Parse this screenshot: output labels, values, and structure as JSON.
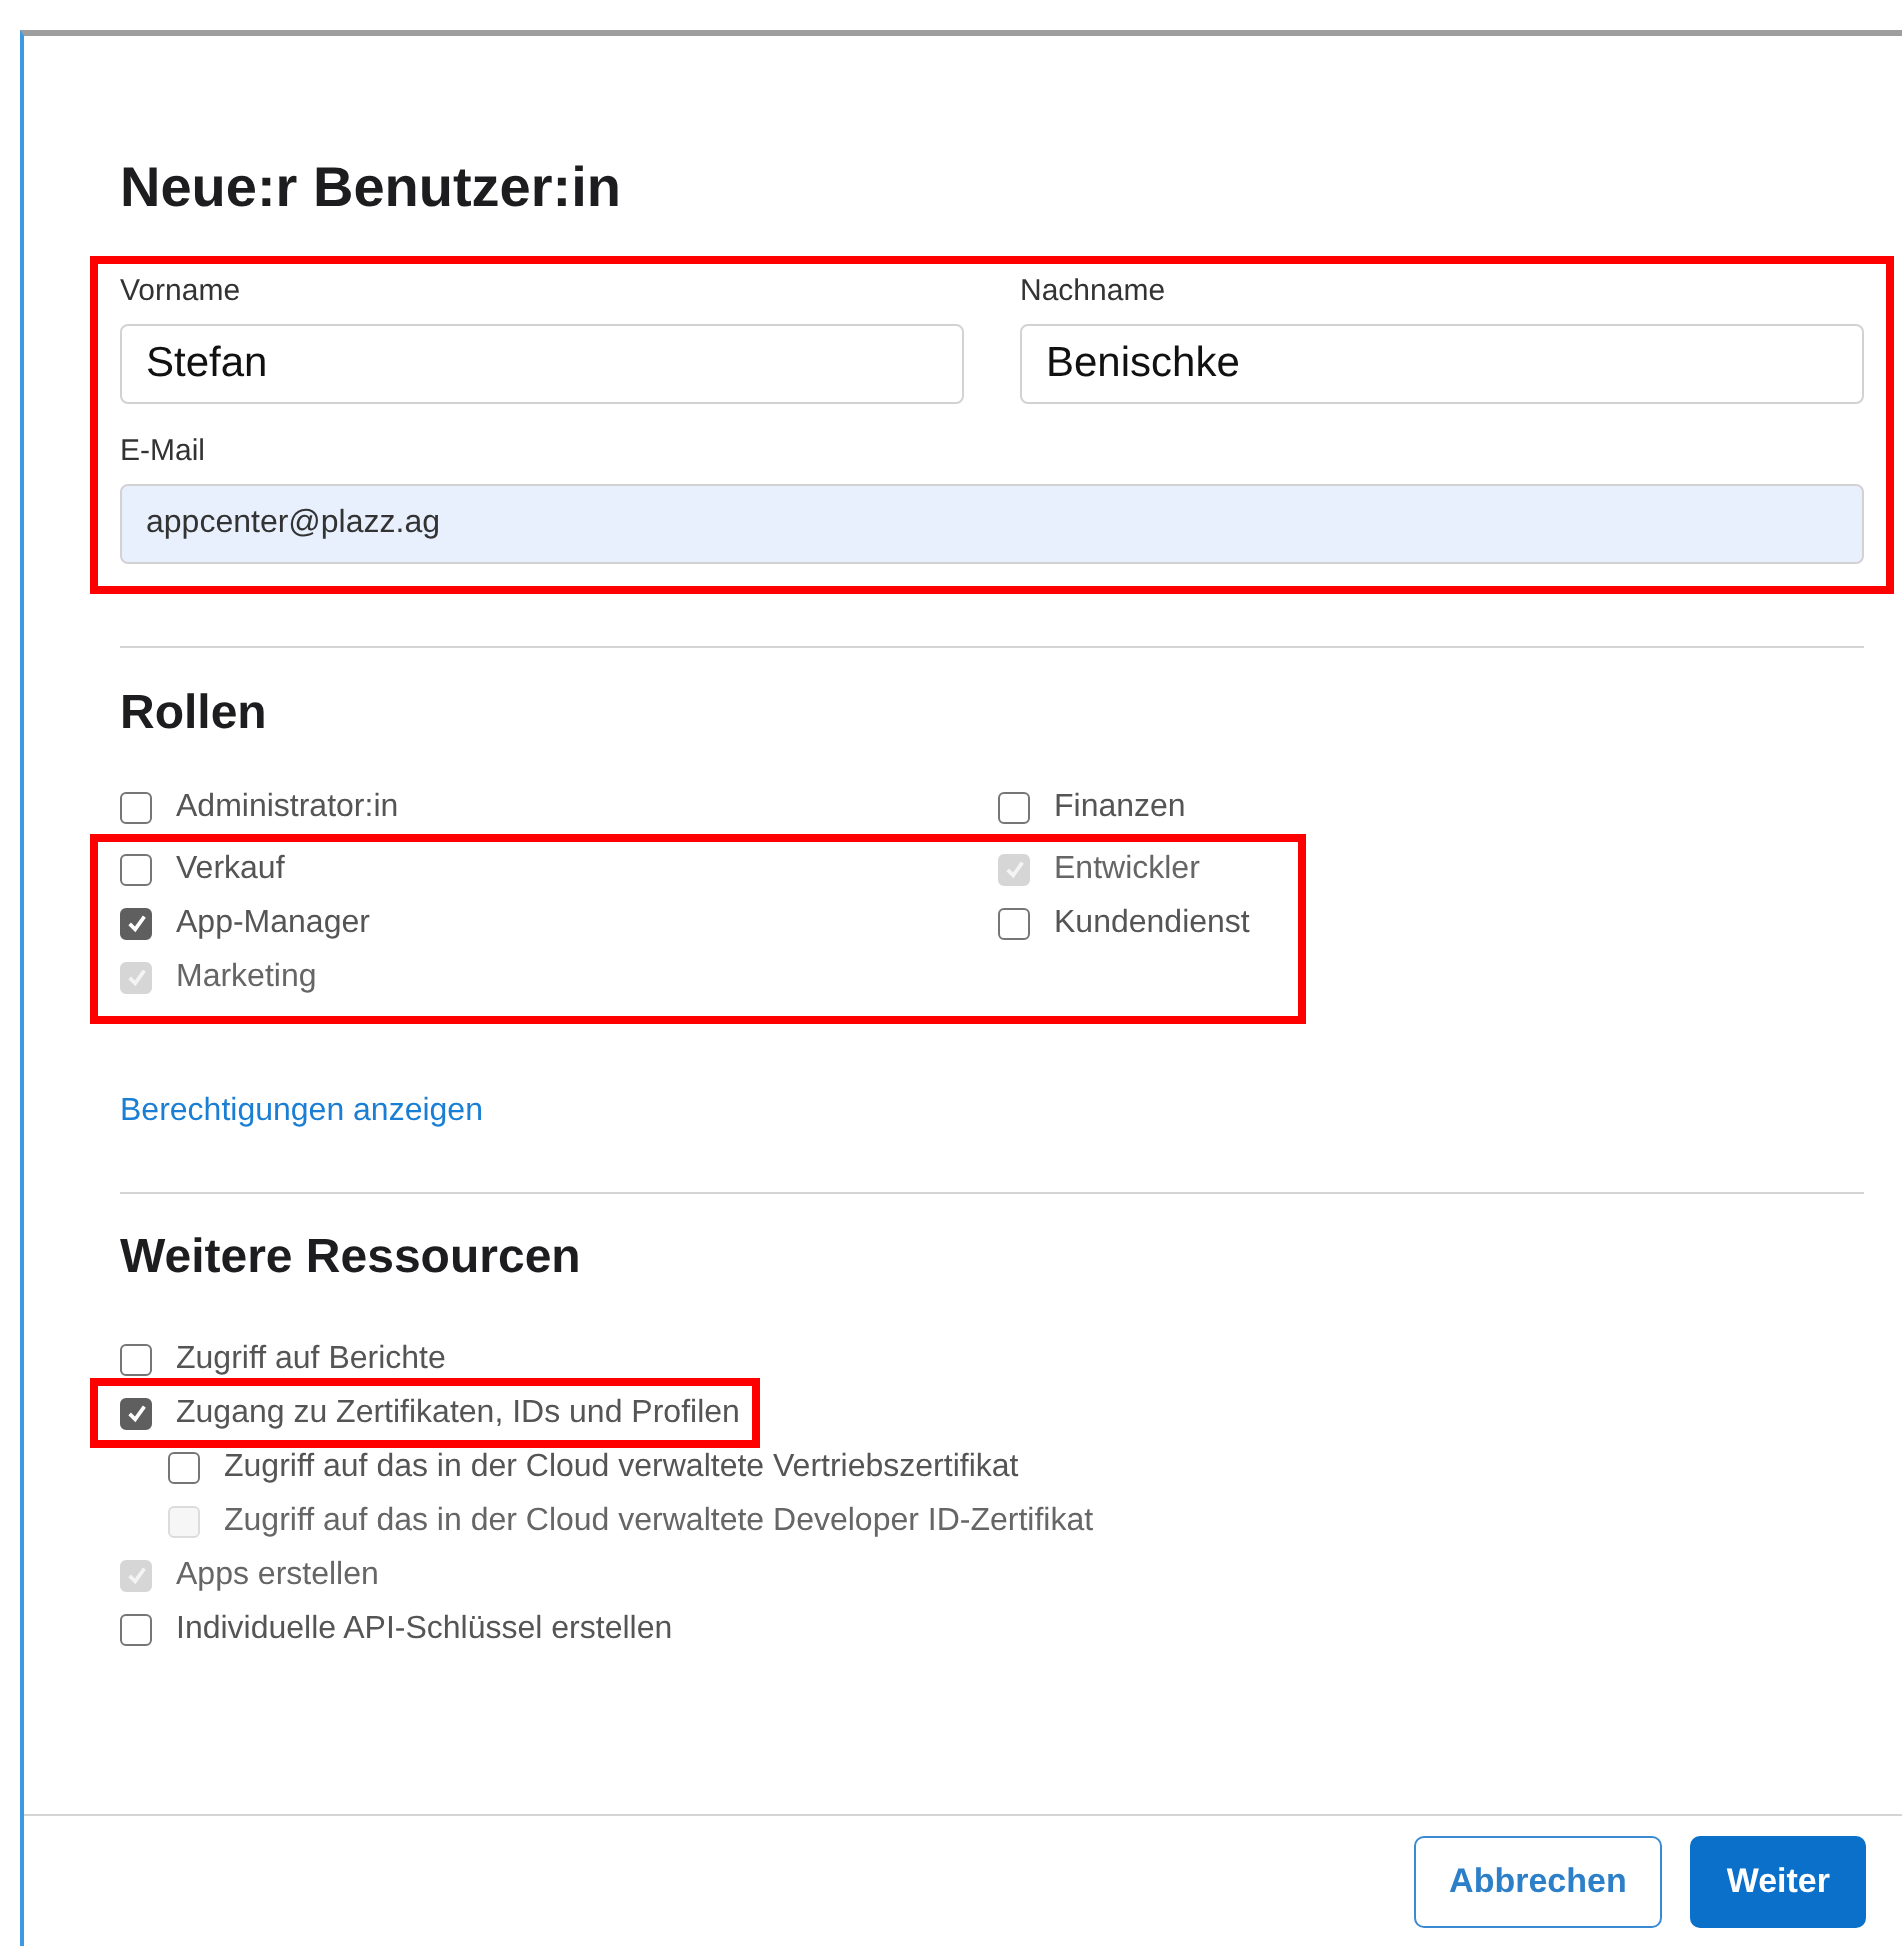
{
  "dialog": {
    "title": "Neue:r Benutzer:in"
  },
  "person": {
    "highlighted": true,
    "fields": [
      {
        "label": "Vorname",
        "value": "Stefan",
        "autofilled": false
      },
      {
        "label": "Nachname",
        "value": "Benischke",
        "autofilled": false
      },
      {
        "label": "E-Mail",
        "value": "appcenter@plazz.ag",
        "autofilled": true
      }
    ]
  },
  "roles": {
    "heading": "Rollen",
    "groups": [
      {
        "highlighted": false,
        "left": [
          {
            "label": "Administrator:in",
            "checked": false,
            "disabled": false
          }
        ],
        "right": [
          {
            "label": "Finanzen",
            "checked": false,
            "disabled": false
          }
        ]
      },
      {
        "highlighted": true,
        "left": [
          {
            "label": "Verkauf",
            "checked": false,
            "disabled": false
          },
          {
            "label": "App-Manager",
            "checked": true,
            "disabled": false
          },
          {
            "label": "Marketing",
            "checked": true,
            "disabled": true
          }
        ],
        "right": [
          {
            "label": "Entwickler",
            "checked": true,
            "disabled": true
          },
          {
            "label": "Kundendienst",
            "checked": false,
            "disabled": false
          }
        ]
      }
    ]
  },
  "permissions_link": "Berechtigungen anzeigen",
  "resources": {
    "heading": "Weitere Ressourcen",
    "items": [
      {
        "label": "Zugriff auf Berichte",
        "checked": false,
        "disabled": false,
        "highlighted": false
      },
      {
        "label": "Zugang zu Zertifikaten, IDs und Profilen",
        "checked": true,
        "disabled": false,
        "highlighted": true,
        "children": [
          {
            "label": "Zugriff auf das in der Cloud verwaltete Vertriebszertifikat",
            "checked": false,
            "disabled": false
          },
          {
            "label": "Zugriff auf das in der Cloud verwaltete Developer ID-Zertifikat",
            "checked": false,
            "disabled": true
          }
        ]
      },
      {
        "label": "Apps erstellen",
        "checked": true,
        "disabled": true,
        "highlighted": false
      },
      {
        "label": "Individuelle API-Schlüssel erstellen",
        "checked": false,
        "disabled": false,
        "highlighted": false
      }
    ]
  },
  "buttons": [
    {
      "label": "Abbrechen",
      "kind": "secondary"
    },
    {
      "label": "Weiter",
      "kind": "primary"
    }
  ]
}
